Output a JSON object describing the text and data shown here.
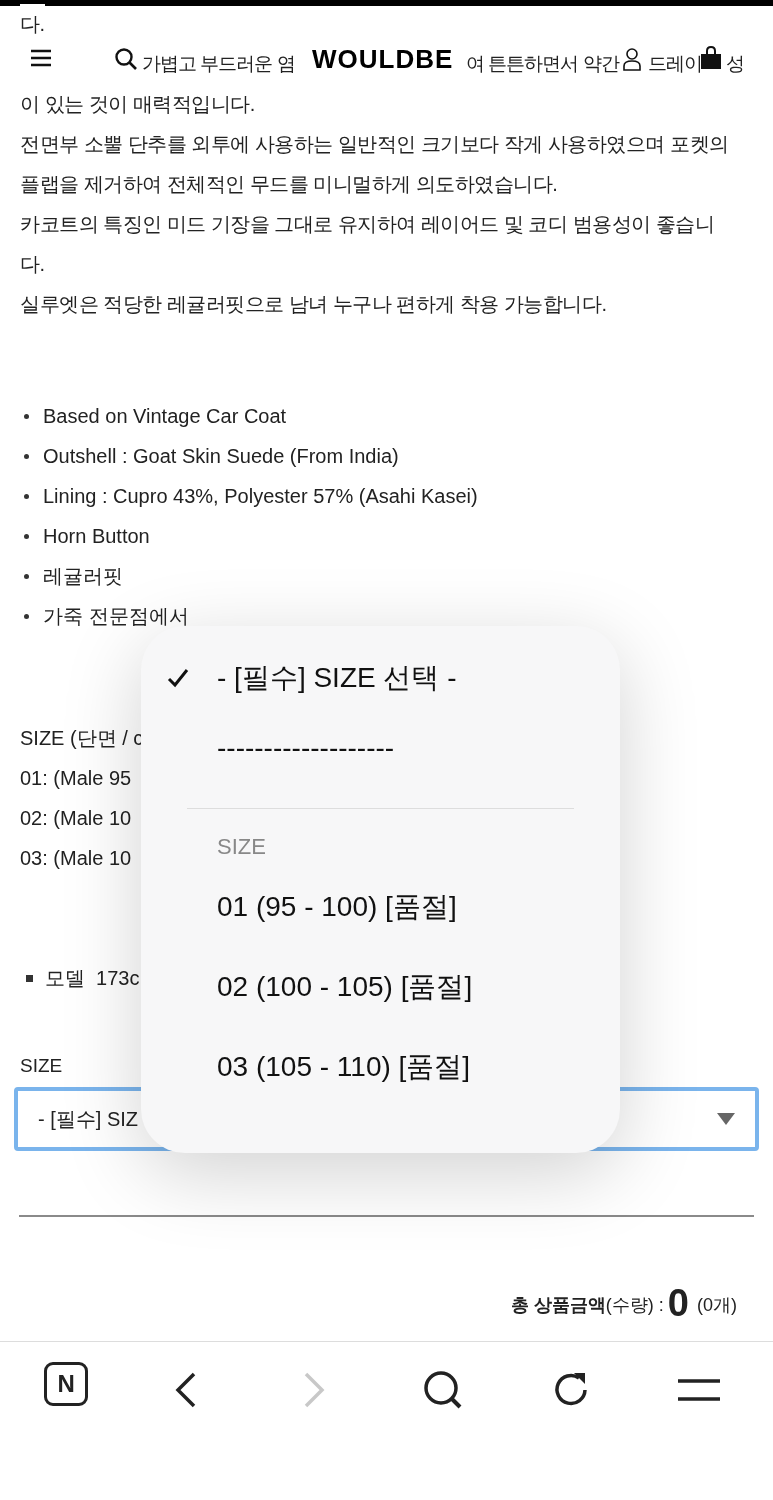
{
  "header": {
    "logo": "WOULDBE"
  },
  "description": [
    "다.",
    [
      "가볍고 부드러운 염",
      "여 튼튼하면서 약간",
      "드레이",
      "성"
    ],
    "이 있는 것이 매력적입니다.",
    "전면부 소뿔 단추를 외투에 사용하는 일반적인 크기보다 작게 사용하였으며 포켓의",
    "플랩을 제거하여 전체적인 무드를 미니멀하게 의도하였습니다.",
    "카코트의 특징인 미드 기장을 그대로 유지하여 레이어드 및 코디 범용성이 좋습니",
    "다.",
    "실루엣은 적당한 레귤러핏으로 남녀 누구나 편하게 착용 가능합니다."
  ],
  "features": [
    "Based on Vintage Car Coat",
    "Outshell : Goat Skin Suede (From India)",
    "Lining : Cupro 43%, Polyester 57% (Asahi Kasei)",
    "Horn Button",
    "레귤러핏",
    "가죽 전문점에서"
  ],
  "size_info": [
    "SIZE (단면 / c",
    "01: (Male 95",
    "02: (Male 10",
    "03: (Male 10"
  ],
  "model_note": "모델  173c",
  "option": {
    "label": "SIZE",
    "value": "- [필수] SIZ",
    "focused": true
  },
  "total": {
    "label": "**총 상품금액**(수량) :",
    "amount": "0",
    "count": "(0개)"
  },
  "dropdown": {
    "items": [
      {
        "kind": "option",
        "label": "- [필수] SIZE 선택 -",
        "selected": true
      },
      {
        "kind": "option",
        "label": "-------------------",
        "selected": false
      },
      {
        "kind": "divider"
      },
      {
        "kind": "header",
        "label": "SIZE"
      },
      {
        "kind": "option",
        "label": "01 (95 - 100) [품절]",
        "selected": false
      },
      {
        "kind": "option",
        "label": "02 (100 - 105) [품절]",
        "selected": false
      },
      {
        "kind": "option",
        "label": "03 (105 - 110) [품절]",
        "selected": false
      }
    ]
  },
  "browser_bar": {
    "buttons": [
      {
        "kind": "logo",
        "label": "N",
        "disabled": false
      },
      {
        "kind": "back",
        "disabled": false
      },
      {
        "kind": "forward",
        "disabled": true
      },
      {
        "kind": "search",
        "disabled": false
      },
      {
        "kind": "reload",
        "disabled": false
      },
      {
        "kind": "menu",
        "disabled": false
      }
    ]
  }
}
